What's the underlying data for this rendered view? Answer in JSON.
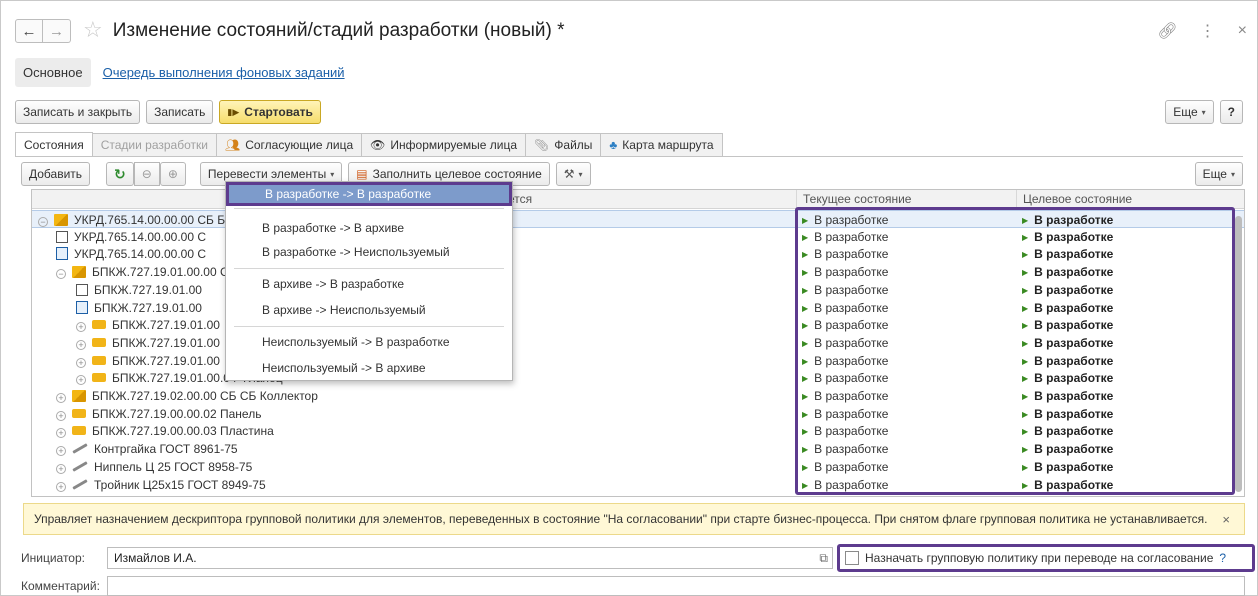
{
  "window": {
    "title": "Изменение состояний/стадий разработки (новый) *"
  },
  "form_tabs": {
    "main": "Основное",
    "queue_link": "Очередь выполнения фоновых заданий"
  },
  "toolbar": {
    "save_close": "Записать и закрыть",
    "save": "Записать",
    "start": "Стартовать",
    "more": "Еще",
    "help": "?"
  },
  "page_tabs": [
    {
      "label": "Состояния"
    },
    {
      "label": "Стадии разработки"
    },
    {
      "label": "Согласующие лица"
    },
    {
      "label": "Информируемые лица"
    },
    {
      "label": "Файлы"
    },
    {
      "label": "Карта маршрута"
    }
  ],
  "content_toolbar": {
    "add": "Добавить",
    "move_items": "Перевести элементы",
    "fill_target": "Заполнить целевое состояние",
    "more": "Еще"
  },
  "grid": {
    "headers": {
      "name": "ется",
      "current": "Текущее состояние",
      "target": "Целевое состояние"
    },
    "rows": [
      {
        "name": "УКРД.765.14.00.00.00 СБ Б",
        "current": "В разработке",
        "target": "В разработке"
      },
      {
        "name": "УКРД.765.14.00.00.00 С",
        "current": "В разработке",
        "target": "В разработке"
      },
      {
        "name": "УКРД.765.14.00.00.00 С",
        "current": "В разработке",
        "target": "В разработке"
      },
      {
        "name": "БПКЖ.727.19.01.00.00 С",
        "current": "В разработке",
        "target": "В разработке"
      },
      {
        "name": "БПКЖ.727.19.01.00",
        "current": "В разработке",
        "target": "В разработке"
      },
      {
        "name": "БПКЖ.727.19.01.00",
        "current": "В разработке",
        "target": "В разработке"
      },
      {
        "name": "БПКЖ.727.19.01.00",
        "current": "В разработке",
        "target": "В разработке"
      },
      {
        "name": "БПКЖ.727.19.01.00",
        "current": "В разработке",
        "target": "В разработке"
      },
      {
        "name": "БПКЖ.727.19.01.00",
        "current": "В разработке",
        "target": "В разработке"
      },
      {
        "name": "БПКЖ.727.19.01.00.04 Фланец",
        "current": "В разработке",
        "target": "В разработке"
      },
      {
        "name": "БПКЖ.727.19.02.00.00 СБ СБ Коллектор",
        "current": "В разработке",
        "target": "В разработке"
      },
      {
        "name": "БПКЖ.727.19.00.00.02 Панель",
        "current": "В разработке",
        "target": "В разработке"
      },
      {
        "name": "БПКЖ.727.19.00.00.03 Пластина",
        "current": "В разработке",
        "target": "В разработке"
      },
      {
        "name": "Контргайка ГОСТ 8961-75",
        "current": "В разработке",
        "target": "В разработке"
      },
      {
        "name": "Ниппель Ц 25 ГОСТ 8958-75",
        "current": "В разработке",
        "target": "В разработке"
      },
      {
        "name": "Тройник Ц25x15 ГОСТ 8949-75",
        "current": "В разработке",
        "target": "В разработке"
      }
    ]
  },
  "dropdown_menu": [
    "В разработке -> В разработке",
    "В разработке -> В архиве",
    "В разработке -> Неиспользуемый",
    "В архиве -> В разработке",
    "В архиве -> Неиспользуемый",
    "Неиспользуемый -> В разработке",
    "Неиспользуемый -> В архиве"
  ],
  "hint": {
    "text": "Управляет назначением дескриптора групповой политики для элементов, переведенных в состояние \"На согласовании\" при старте бизнес-процесса. При снятом флаге групповая политика не устанавливается.",
    "close": "×"
  },
  "form": {
    "initiator_label": "Инициатор:",
    "initiator_value": "Измайлов И.А.",
    "checkbox_label": "Назначать групповую политику при переводе на согласование",
    "checkbox_help": "?",
    "comment_label": "Комментарий:",
    "comment_value": ""
  },
  "colors": {
    "highlight": "#5d3b8e",
    "start_button": "#f6dd6c",
    "link": "#1a5fa8",
    "state_marker": "#3a8a22"
  }
}
